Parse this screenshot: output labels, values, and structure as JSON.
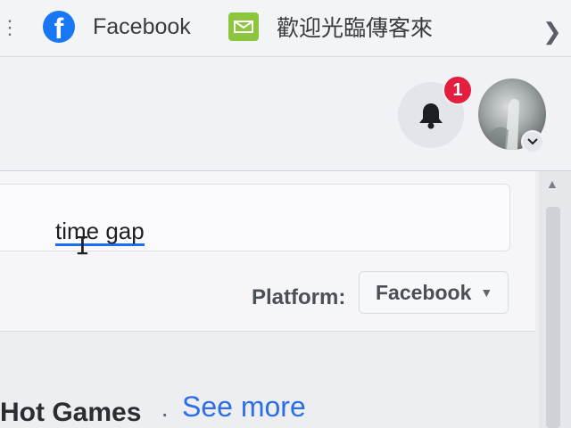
{
  "bookmarks": {
    "items": [
      {
        "label": "Facebook",
        "icon": "facebook-logo-icon"
      },
      {
        "label": "歡迎光臨傳客來",
        "icon": "mail-icon"
      }
    ],
    "overflow_icon": "chevron-right-icon"
  },
  "header": {
    "notifications_icon": "bell-icon",
    "notification_count": "1",
    "avatar_icon": "profile-avatar",
    "account_menu_icon": "chevron-down-icon"
  },
  "search": {
    "value": "time  gap"
  },
  "filter": {
    "platform_label": "Platform:",
    "platform_value": "Facebook"
  },
  "section": {
    "title": "Hot Games",
    "separator": "·",
    "see_more": "See more"
  },
  "colors": {
    "facebook_blue": "#1877f2",
    "badge_red": "#e41e3f",
    "link_blue": "#2d6ee8",
    "mail_green": "#8cc63f"
  }
}
